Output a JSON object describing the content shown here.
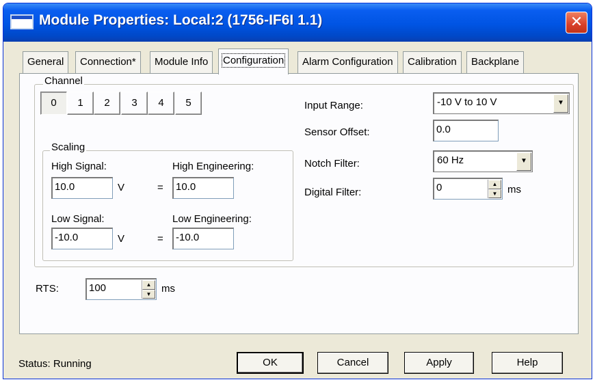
{
  "window": {
    "title": "Module Properties: Local:2 (1756-IF6I 1.1)"
  },
  "tabs": [
    {
      "label": "General"
    },
    {
      "label": "Connection*"
    },
    {
      "label": "Module Info"
    },
    {
      "label": "Configuration"
    },
    {
      "label": "Alarm Configuration"
    },
    {
      "label": "Calibration"
    },
    {
      "label": "Backplane"
    }
  ],
  "active_tab": "Configuration",
  "channel": {
    "legend": "Channel",
    "buttons": [
      "0",
      "1",
      "2",
      "3",
      "4",
      "5"
    ],
    "selected": "0"
  },
  "scaling": {
    "legend": "Scaling",
    "high_signal_label": "High Signal:",
    "high_signal_value": "10.0",
    "high_engineering_label": "High Engineering:",
    "high_engineering_value": "10.0",
    "low_signal_label": "Low Signal:",
    "low_signal_value": "-10.0",
    "low_engineering_label": "Low Engineering:",
    "low_engineering_value": "-10.0",
    "unit": "V",
    "equals": "="
  },
  "settings": {
    "input_range_label": "Input Range:",
    "input_range_value": "-10 V to 10 V",
    "sensor_offset_label": "Sensor Offset:",
    "sensor_offset_value": "0.0",
    "notch_filter_label": "Notch Filter:",
    "notch_filter_value": "60 Hz",
    "digital_filter_label": "Digital Filter:",
    "digital_filter_value": "0",
    "digital_filter_unit": "ms"
  },
  "rts": {
    "label": "RTS:",
    "value": "100",
    "unit": "ms"
  },
  "status": {
    "text": "Status:  Running"
  },
  "buttons": {
    "ok": "OK",
    "cancel": "Cancel",
    "apply": "Apply",
    "help": "Help"
  }
}
